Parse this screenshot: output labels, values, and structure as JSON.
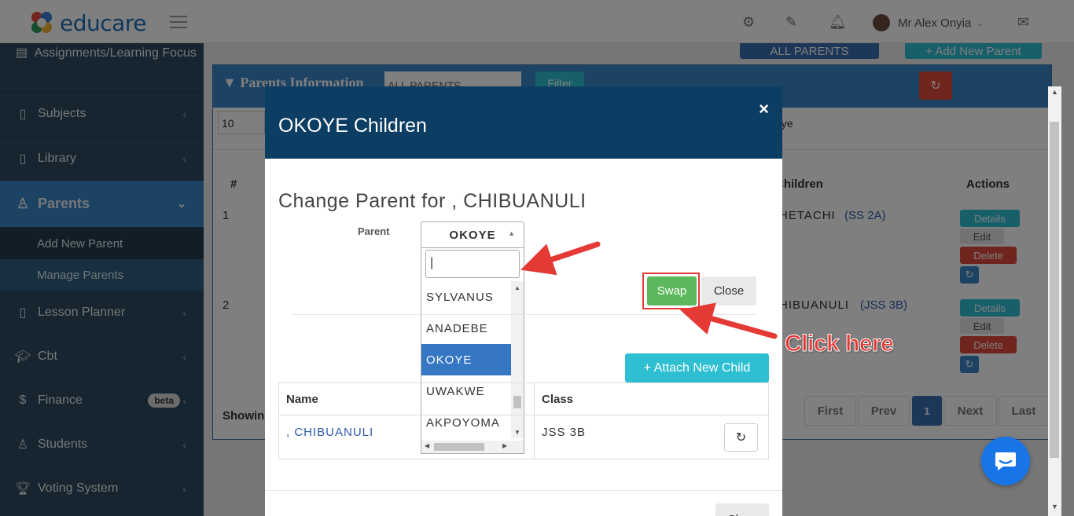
{
  "app": {
    "brand": "educare",
    "user_name": "Mr Alex Onyia"
  },
  "sidebar": {
    "items": [
      {
        "label": "Assignments/Learning Focus",
        "icon": "book-icon"
      },
      {
        "label": "Subjects",
        "icon": "notebook-icon"
      },
      {
        "label": "Library",
        "icon": "book-open-icon"
      },
      {
        "label": "Parents",
        "icon": "user-icon"
      },
      {
        "label": "Add New Parent"
      },
      {
        "label": "Manage Parents"
      },
      {
        "label": "Lesson Planner",
        "icon": "planner-icon"
      },
      {
        "label": "Cbt",
        "icon": "graduation-cap-icon"
      },
      {
        "label": "Finance",
        "icon": "dollar-icon",
        "badge": "beta"
      },
      {
        "label": "Students",
        "icon": "user-icon"
      },
      {
        "label": "Voting System",
        "icon": "trophy-icon"
      }
    ]
  },
  "page": {
    "all_parents_button": "ALL PARENTS",
    "add_new_parent_button": "+ Add New Parent",
    "panel_title": "Parents Information",
    "filter_select": "ALL PARENTS",
    "filter_button": "Filter",
    "page_size": "10",
    "search_partial": "oye",
    "columns": {
      "index": "#",
      "children": "Children",
      "actions": "Actions"
    },
    "rows": [
      {
        "index": "1",
        "child": "HETACHI",
        "class": "(SS 2A)"
      },
      {
        "index": "2",
        "child": "HIBUANULI",
        "class": "(JSS 3B)"
      }
    ],
    "row_actions": {
      "details": "Details",
      "edit": "Edit",
      "delete": "Delete"
    },
    "showing": "Showin",
    "pagination": {
      "first": "First",
      "prev": "Prev",
      "current": "1",
      "next": "Next",
      "last": "Last"
    }
  },
  "modal": {
    "title": "OKOYE Children",
    "heading": "Change Parent for , CHIBUANULI",
    "parent_label": "Parent",
    "parent_selected": "OKOYE",
    "search_value": "",
    "options": [
      "SYLVANUS",
      "ANADEBE",
      "OKOYE",
      "UWAKWE",
      "AKPOYOMA"
    ],
    "selected_option": "OKOYE",
    "swap_button": "Swap",
    "close_button": "Close",
    "attach_button": "+ Attach New Child",
    "table": {
      "headers": [
        "Name",
        "Class"
      ],
      "rows": [
        {
          "name": ", CHIBUANULI",
          "class": "JSS 3B"
        }
      ]
    },
    "footer_button": "Close"
  },
  "annotation": {
    "text": "Click here",
    "color": "#e53935"
  },
  "colors": {
    "sidebar": "#2c4a5e",
    "active": "#3a86c8",
    "modal_header": "#0c3d62",
    "swap": "#5cb85c",
    "attach": "#2ebfd2"
  }
}
